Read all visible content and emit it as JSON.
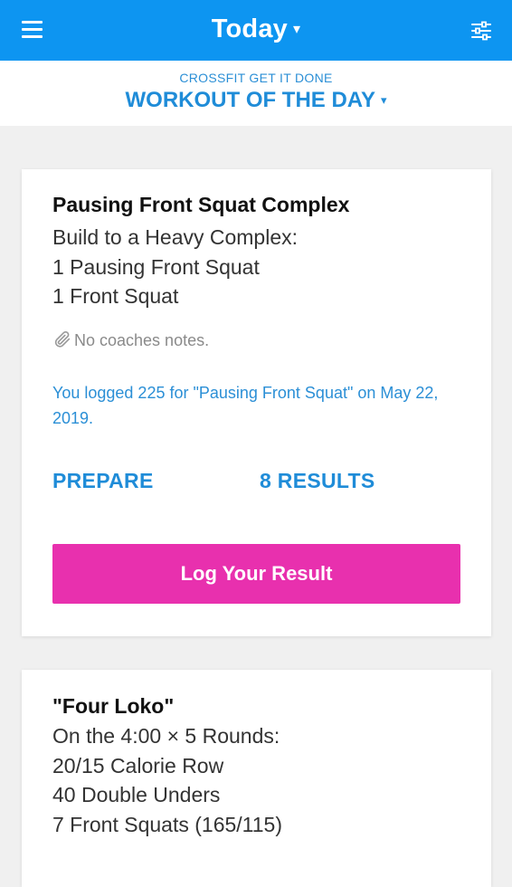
{
  "header": {
    "title": "Today",
    "title_caret": "▾",
    "menu_icon": "hamburger-menu-icon",
    "filter_icon": "sliders-filter-icon",
    "bg_color": "#0d95f1"
  },
  "subheader": {
    "gym_name": "CROSSFIT GET IT DONE",
    "track": "WORKOUT OF THE DAY",
    "track_caret": "▾"
  },
  "workouts": [
    {
      "title": "Pausing Front Squat Complex",
      "lines": [
        "Build to a Heavy Complex:",
        "1 Pausing Front Squat",
        "1 Front Squat"
      ],
      "coach_notes": "No coaches notes.",
      "notes_icon": "paperclip-icon",
      "logged_text": "You logged 225 for \"Pausing Front Squat\" on May 22, 2019.",
      "prepare_label": "PREPARE",
      "results_label": "8 RESULTS",
      "log_button": "Log Your Result"
    },
    {
      "title": "\"Four Loko\"",
      "lines": [
        "On the 4:00 × 5 Rounds:",
        "20/15 Calorie Row",
        "40 Double Unders",
        "7 Front Squats (165/115)"
      ]
    }
  ],
  "colors": {
    "accent_blue": "#1f8cd8",
    "log_button": "#e830ae"
  }
}
